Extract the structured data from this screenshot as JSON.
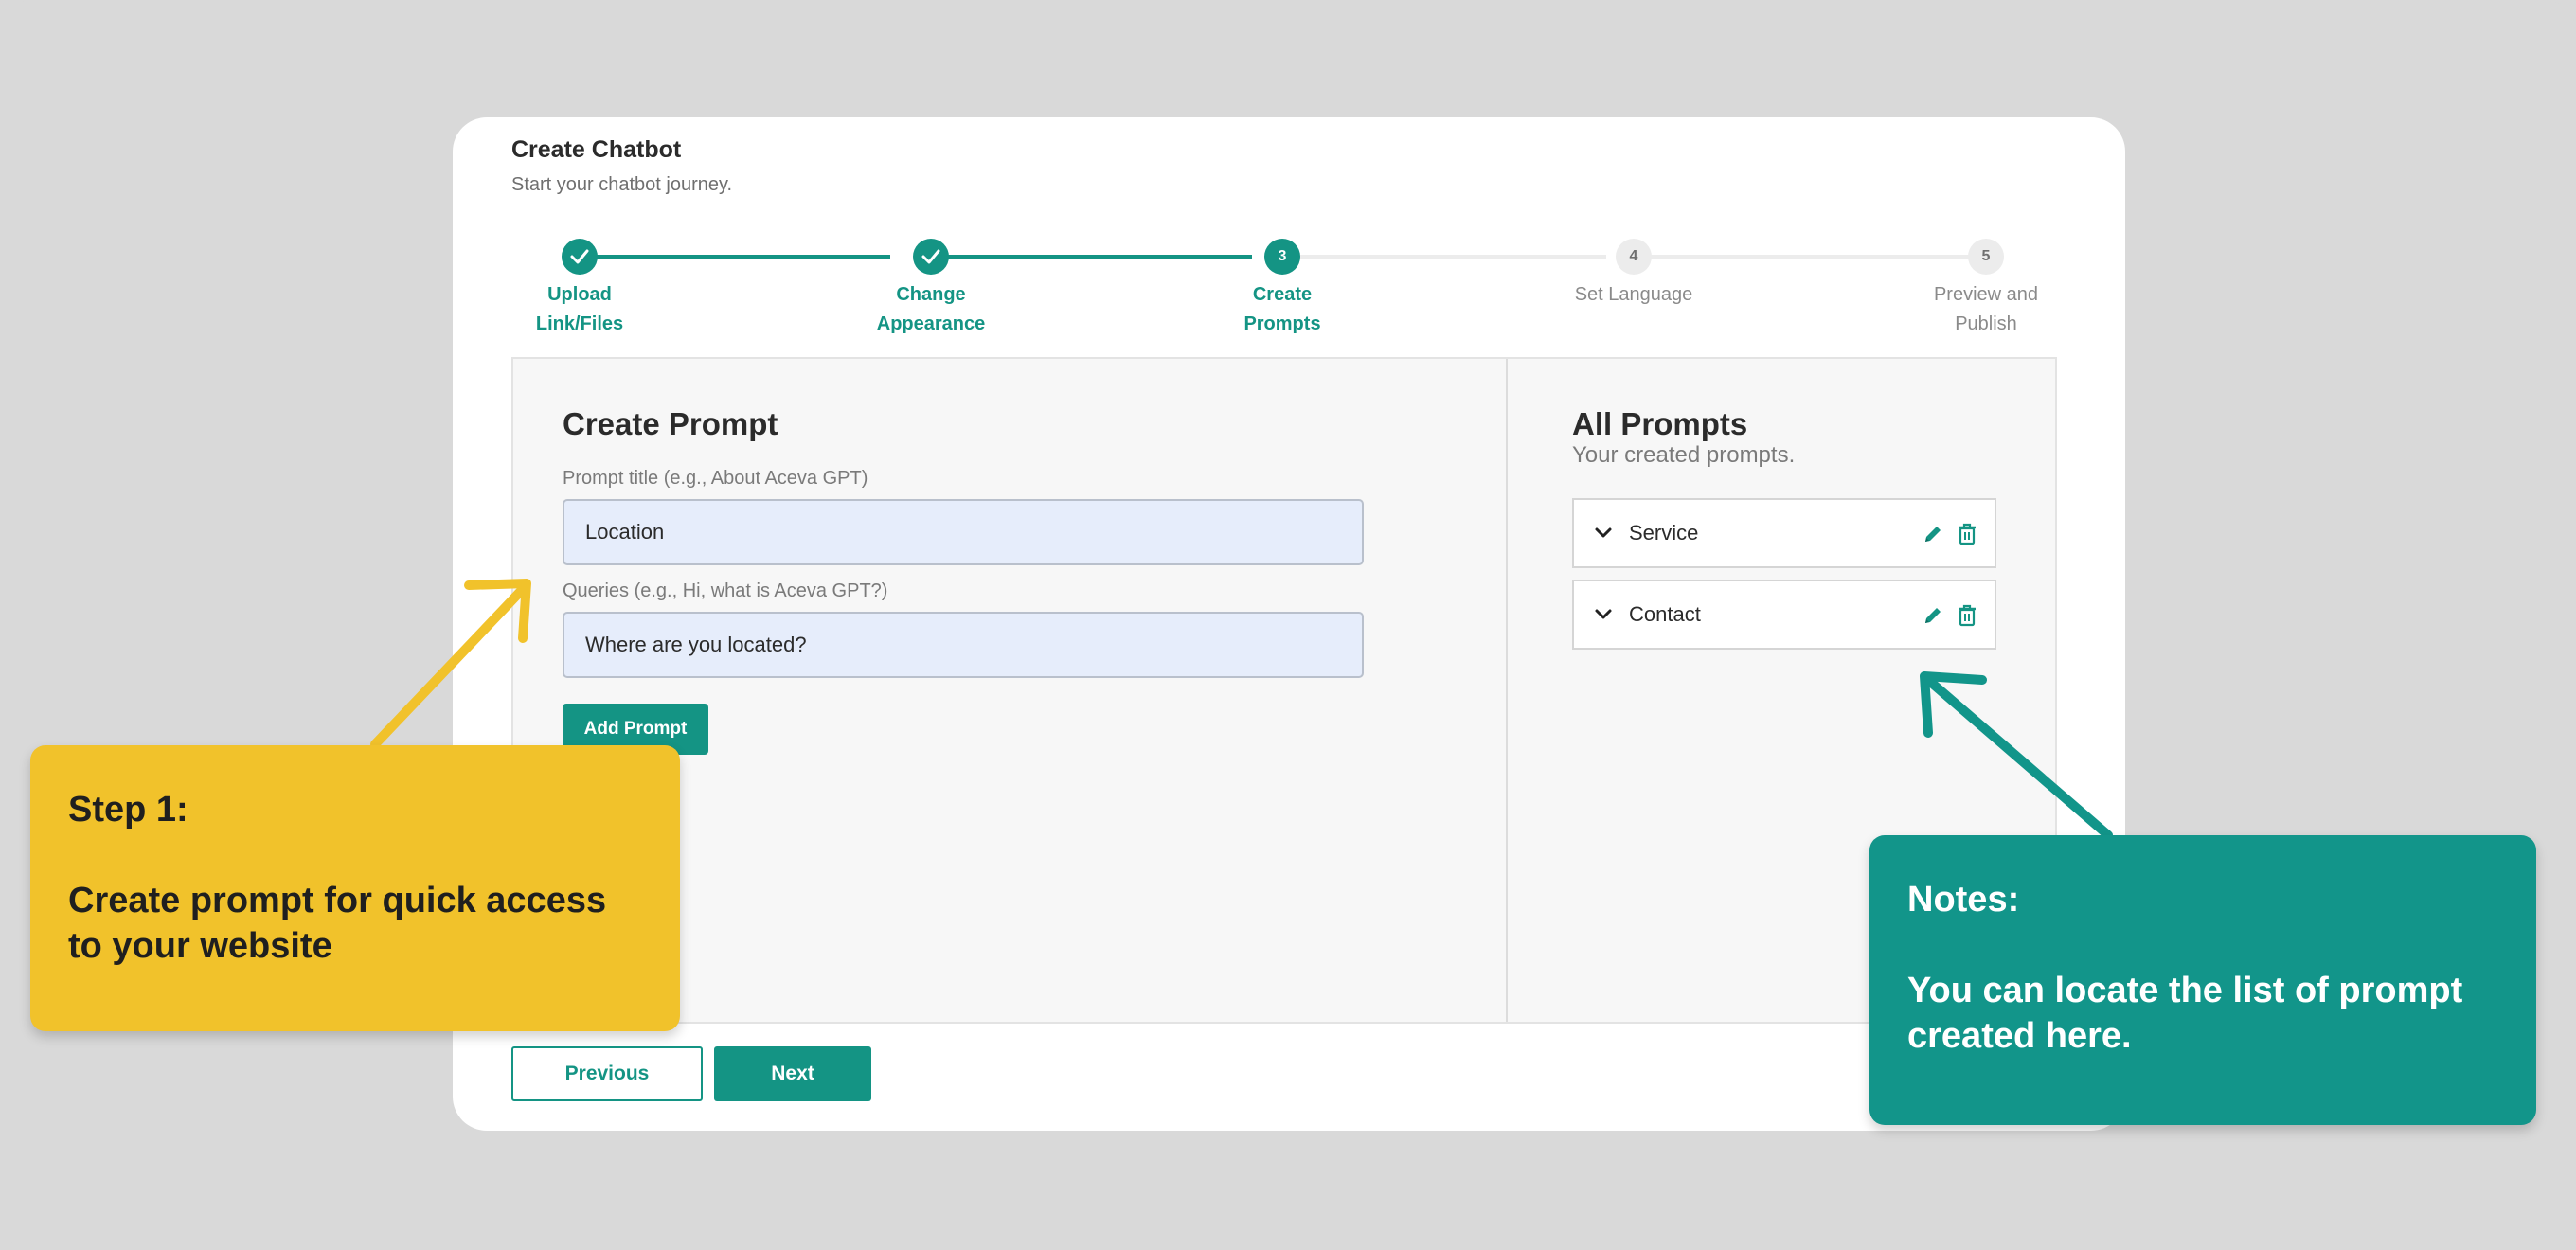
{
  "card": {
    "title": "Create Chatbot",
    "subtitle": "Start your chatbot journey."
  },
  "stepper": {
    "steps": [
      {
        "label_line1": "Upload",
        "label_line2": "Link/Files",
        "state": "done"
      },
      {
        "label_line1": "Change",
        "label_line2": "Appearance",
        "state": "done"
      },
      {
        "number": "3",
        "label_line1": "Create",
        "label_line2": "Prompts",
        "state": "active"
      },
      {
        "number": "4",
        "label_line1": "Set Language",
        "label_line2": "",
        "state": "todo"
      },
      {
        "number": "5",
        "label_line1": "Preview and",
        "label_line2": "Publish",
        "state": "todo"
      }
    ]
  },
  "create_prompt": {
    "heading": "Create Prompt",
    "title_label": "Prompt title (e.g., About Aceva GPT)",
    "title_value": "Location",
    "queries_label": "Queries (e.g., Hi, what is Aceva GPT?)",
    "queries_value": "Where are you located?",
    "add_button": "Add Prompt"
  },
  "all_prompts": {
    "heading": "All Prompts",
    "subtitle": "Your created prompts.",
    "items": [
      {
        "name": "Service"
      },
      {
        "name": "Contact"
      }
    ]
  },
  "nav": {
    "previous": "Previous",
    "next": "Next"
  },
  "callouts": {
    "step1_title": "Step 1:",
    "step1_body": "Create prompt for quick access\nto your website",
    "notes_title": "Notes:",
    "notes_body": "You can locate the list of prompt\ncreated here."
  },
  "colors": {
    "accent": "#149484",
    "callout_yellow": "#f1c22b",
    "callout_green": "#12958a",
    "background": "#d9d9d9"
  }
}
